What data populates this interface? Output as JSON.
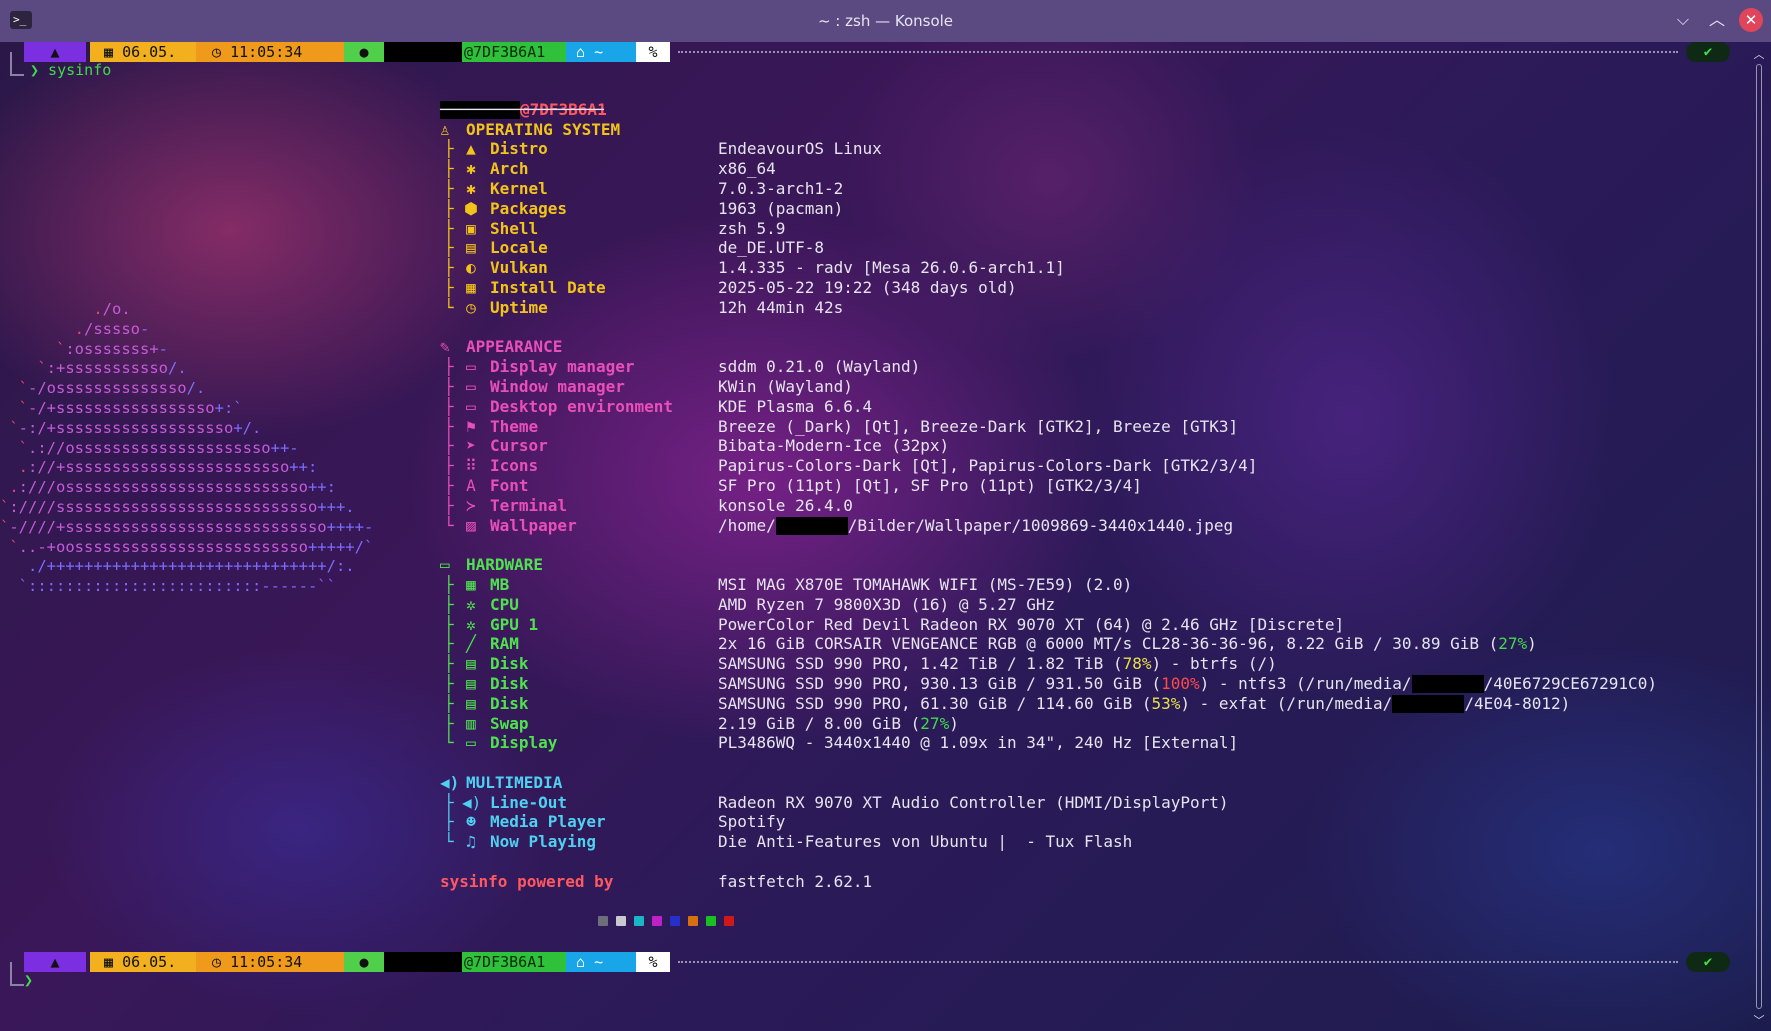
{
  "window": {
    "title": "~ : zsh — Konsole",
    "app_icon": ">_"
  },
  "colors": {
    "os": "#f2c419",
    "appearance": "#e84fb8",
    "hardware": "#4ee34e",
    "multimedia": "#4fd0f0",
    "host": "#ff5860",
    "powered": "#ff5860",
    "green_text": "#43d94c",
    "yellow_pct": "#e6e04a",
    "red_pct": "#ff4848"
  },
  "prompt": {
    "arch_icon": "▲",
    "date_icon": "▦",
    "date": "06.05.",
    "time_icon": "◷",
    "time": "11:05:34",
    "user_icon": "●",
    "host": "@7DF3B6A1",
    "home_icon": "⌂",
    "dir": "~",
    "pct": "%",
    "status_icon": "✔"
  },
  "command": "❯ sysinfo",
  "command2_prompt": "❯",
  "info": {
    "host_line": "@7DF3B6A1",
    "separator": "─────────────────",
    "os_header": "OPERATING SYSTEM",
    "os_icon": "♙",
    "os": [
      {
        "icon": "▲",
        "label": "Distro",
        "value": "EndeavourOS Linux"
      },
      {
        "icon": "✱",
        "label": "Arch",
        "value": "x86_64"
      },
      {
        "icon": "✱",
        "label": "Kernel",
        "value": "7.0.3-arch1-2"
      },
      {
        "icon": "⬢",
        "label": "Packages",
        "value": "1963 (pacman)"
      },
      {
        "icon": "▣",
        "label": "Shell",
        "value": "zsh 5.9"
      },
      {
        "icon": "▤",
        "label": "Locale",
        "value": "de_DE.UTF-8"
      },
      {
        "icon": "◐",
        "label": "Vulkan",
        "value": "1.4.335 - radv [Mesa 26.0.6-arch1.1]"
      },
      {
        "icon": "▦",
        "label": "Install Date",
        "value": "2025-05-22 19:22 (348 days old)"
      },
      {
        "icon": "◷",
        "label": "Uptime",
        "value": "12h 44min 42s"
      }
    ],
    "appearance_header": "APPEARANCE",
    "appearance_icon": "✎",
    "appearance": [
      {
        "icon": "▭",
        "label": "Display manager",
        "value": "sddm 0.21.0 (Wayland)"
      },
      {
        "icon": "▭",
        "label": "Window manager",
        "value": "KWin (Wayland)"
      },
      {
        "icon": "▭",
        "label": "Desktop environment",
        "value": "KDE Plasma 6.6.4"
      },
      {
        "icon": "⚑",
        "label": "Theme",
        "value": "Breeze (_Dark) [Qt], Breeze-Dark [GTK2], Breeze [GTK3]"
      },
      {
        "icon": "➤",
        "label": "Cursor",
        "value": "Bibata-Modern-Ice (32px)"
      },
      {
        "icon": "⠿",
        "label": "Icons",
        "value": "Papirus-Colors-Dark [Qt], Papirus-Colors-Dark [GTK2/3/4]"
      },
      {
        "icon": "A",
        "label": "Font",
        "value": "SF Pro (11pt) [Qt], SF Pro (11pt) [GTK2/3/4]"
      },
      {
        "icon": "≻",
        "label": "Terminal",
        "value": "konsole 26.4.0"
      },
      {
        "icon": "▨",
        "label": "Wallpaper",
        "value_pre": "/home/",
        "value_post": "/Bilder/Wallpaper/1009869-3440x1440.jpeg"
      }
    ],
    "hardware_header": "HARDWARE",
    "hardware_icon": "▭",
    "hardware": [
      {
        "icon": "▦",
        "label": "MB",
        "value": "MSI MAG X870E TOMAHAWK WIFI (MS-7E59) (2.0)"
      },
      {
        "icon": "✲",
        "label": "CPU",
        "value": "AMD Ryzen 7 9800X3D (16) @ 5.27 GHz"
      },
      {
        "icon": "✲",
        "label": "GPU 1",
        "value": "PowerColor Red Devil Radeon RX 9070 XT (64) @ 2.46 GHz [Discrete]"
      },
      {
        "icon": "╱",
        "label": "RAM",
        "value_pre": "2x 16 GiB CORSAIR VENGEANCE RGB @ 6000 MT/s CL28-36-36-96, 8.22 GiB / 30.89 GiB (",
        "pct": "27%",
        "pct_color": "green",
        "value_post": ")"
      },
      {
        "icon": "▤",
        "label": "Disk",
        "value_pre": "SAMSUNG SSD 990 PRO, 1.42 TiB / 1.82 TiB (",
        "pct": "78%",
        "pct_color": "yellow",
        "value_post": ") - btrfs (/)"
      },
      {
        "icon": "▤",
        "label": "Disk",
        "value_pre": "SAMSUNG SSD 990 PRO, 930.13 GiB / 931.50 GiB (",
        "pct": "100%",
        "pct_color": "red",
        "value_post": ") - ntfs3 (/run/media/",
        "value_end": "/40E6729CE67291C0)"
      },
      {
        "icon": "▤",
        "label": "Disk",
        "value_pre": "SAMSUNG SSD 990 PRO, 61.30 GiB / 114.60 GiB (",
        "pct": "53%",
        "pct_color": "yellow",
        "value_post": ") - exfat (/run/media/",
        "value_end": "/4E04-8012)"
      },
      {
        "icon": "▥",
        "label": "Swap",
        "value_pre": "2.19 GiB / 8.00 GiB (",
        "pct": "27%",
        "pct_color": "green",
        "value_post": ")"
      },
      {
        "icon": "▭",
        "label": "Display",
        "value": "PL3486WQ - 3440x1440 @ 1.09x in 34\", 240 Hz [External]"
      }
    ],
    "multimedia_header": "MULTIMEDIA",
    "multimedia_icon": "◀)",
    "multimedia": [
      {
        "icon": "◀)",
        "label": "Line-Out",
        "value": "Radeon RX 9070 XT Audio Controller (HDMI/DisplayPort)"
      },
      {
        "icon": "☻",
        "label": "Media Player",
        "value": "Spotify"
      },
      {
        "icon": "♫",
        "label": "Now Playing",
        "value": "Die Anti-Features von Ubuntu |  - Tux Flash"
      }
    ],
    "powered_label": "sysinfo powered by",
    "powered_value": "fastfetch 2.62.1"
  },
  "palette": [
    "#6e6e7a",
    "#c8c8d0",
    "#19b6c6",
    "#c020c8",
    "#2430c8",
    "#d87010",
    "#18c020",
    "#d01818"
  ],
  "logo": {
    "lines": [
      [
        {
          "t": "          .",
          "c": "p"
        },
        {
          "t": "/o.",
          "c": "m"
        }
      ],
      [
        {
          "t": "        .",
          "c": "p"
        },
        {
          "t": "/sssso",
          "c": "m"
        },
        {
          "t": "-",
          "c": "b"
        }
      ],
      [
        {
          "t": "      `",
          "c": "p"
        },
        {
          "t": ":osssssss+",
          "c": "m"
        },
        {
          "t": "-",
          "c": "b"
        }
      ],
      [
        {
          "t": "    `",
          "c": "p"
        },
        {
          "t": ":+sssssssssso",
          "c": "m"
        },
        {
          "t": "/.",
          "c": "b"
        }
      ],
      [
        {
          "t": "  `",
          "c": "p"
        },
        {
          "t": "-/ossssssssssssso",
          "c": "m"
        },
        {
          "t": "/.",
          "c": "b"
        }
      ],
      [
        {
          "t": "  `",
          "c": "p"
        },
        {
          "t": "-/+sssssssssssssssso",
          "c": "m"
        },
        {
          "t": "+:`",
          "c": "b"
        }
      ],
      [
        {
          "t": " `",
          "c": "p"
        },
        {
          "t": "-:/+sssssssssssssssssso",
          "c": "m"
        },
        {
          "t": "+/.",
          "c": "b"
        }
      ],
      [
        {
          "t": "  `",
          "c": "p"
        },
        {
          "t": ".://osssssssssssssssssssso",
          "c": "m"
        },
        {
          "t": "++-",
          "c": "b"
        }
      ],
      [
        {
          "t": "  .",
          "c": "p"
        },
        {
          "t": "://+ssssssssssssssssssssssso",
          "c": "m"
        },
        {
          "t": "++:",
          "c": "b"
        }
      ],
      [
        {
          "t": " .",
          "c": "p"
        },
        {
          "t": ":///ossssssssssssssssssssssssso",
          "c": "m"
        },
        {
          "t": "++:",
          "c": "b"
        }
      ],
      [
        {
          "t": "`",
          "c": "p"
        },
        {
          "t": ":////ssssssssssssssssssssssssssso",
          "c": "m"
        },
        {
          "t": "+++.",
          "c": "b"
        }
      ],
      [
        {
          "t": "`",
          "c": "p"
        },
        {
          "t": "-////+ssssssssssssssssssssssssssso",
          "c": "m"
        },
        {
          "t": "++++-",
          "c": "b"
        }
      ],
      [
        {
          "t": " `",
          "c": "p"
        },
        {
          "t": "..-+oosssssssssssssssssssssssso",
          "c": "m"
        },
        {
          "t": "+++++/`",
          "c": "b"
        }
      ],
      [
        {
          "t": "   ./++++++++++++++++++++++++++++++/:.",
          "c": "b"
        }
      ],
      [
        {
          "t": "  `:::::::::::::::::::::::::------``",
          "c": "b"
        }
      ]
    ]
  }
}
